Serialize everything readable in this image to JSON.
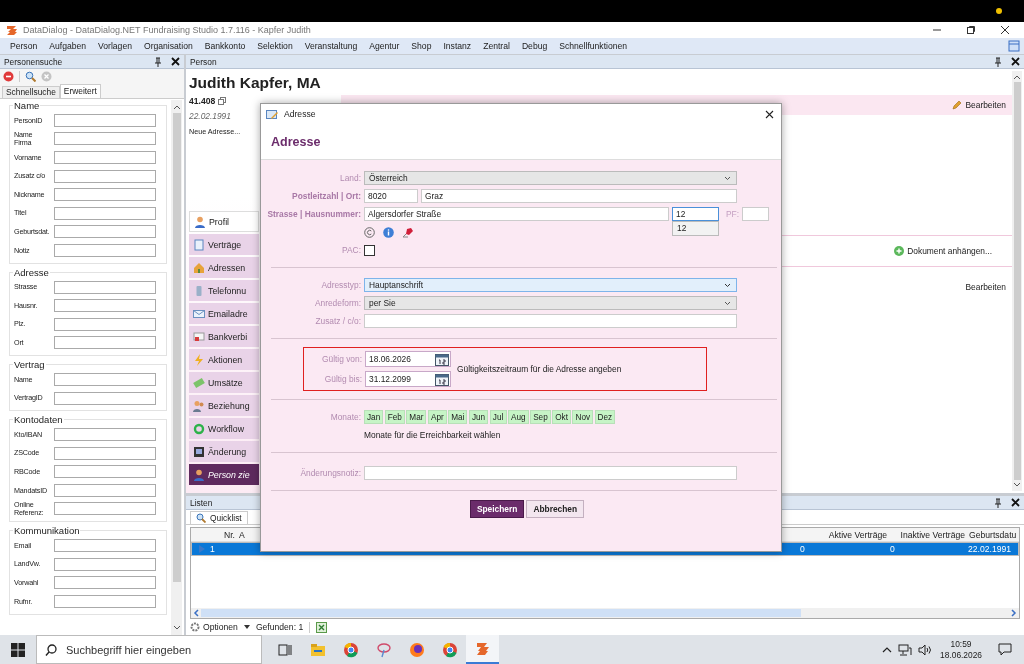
{
  "window": {
    "title": "DataDialog - DataDialog.NET Fundraising Studio 1.7.116 - Kapfer Judith"
  },
  "menu": [
    "Person",
    "Aufgaben",
    "Vorlagen",
    "Organisation",
    "Bankkonto",
    "Selektion",
    "Veranstaltung",
    "Agentur",
    "Shop",
    "Instanz",
    "Zentral",
    "Debug",
    "Schnellfunktionen"
  ],
  "search_panel": {
    "title": "Personensuche",
    "tabs": [
      {
        "label": "Schnellsuche",
        "selected": false
      },
      {
        "label": "Erweitert",
        "selected": true
      }
    ],
    "groups": [
      {
        "title": "Name",
        "fields": [
          "PersonID",
          "Name\nFirma",
          "Vorname",
          "Zusatz c/o",
          "Nickname",
          "Titel",
          "Geburtsdat.",
          "Notiz"
        ]
      },
      {
        "title": "Adresse",
        "fields": [
          "Strasse",
          "Hausnr.",
          "Plz.",
          "Ort"
        ]
      },
      {
        "title": "Vertrag",
        "fields": [
          "Name",
          "VertragID"
        ]
      },
      {
        "title": "Kontodaten",
        "fields": [
          "Kto/IBAN",
          "ZSCode",
          "RBCode",
          "MandatsID",
          "Online\nReferenz:"
        ]
      },
      {
        "title": "Kommunikation",
        "fields": [
          "Email",
          "LandVw.",
          "Vorwahl",
          "Rufnr."
        ]
      }
    ]
  },
  "person_panel": {
    "title": "Person",
    "name": "Judith Kapfer, MA",
    "id": "41.408",
    "birthdate": "22.02.1991",
    "note": "Neue Adresse...",
    "nav": [
      {
        "label": "Profil",
        "selected": true,
        "kind": "page"
      },
      {
        "label": "Verträge",
        "selected": false,
        "kind": "page"
      },
      {
        "label": "Adressen",
        "selected": false,
        "kind": "page"
      },
      {
        "label": "Telefonnu",
        "selected": false,
        "kind": "page"
      },
      {
        "label": "Emailadre",
        "selected": false,
        "kind": "page"
      },
      {
        "label": "Bankverbi",
        "selected": false,
        "kind": "page"
      },
      {
        "label": "Aktionen",
        "selected": false,
        "kind": "page"
      },
      {
        "label": "Umsätze",
        "selected": false,
        "kind": "page"
      },
      {
        "label": "Beziehung",
        "selected": false,
        "kind": "page"
      },
      {
        "label": "Workflow",
        "selected": false,
        "kind": "page"
      },
      {
        "label": "Änderung",
        "selected": false,
        "kind": "page"
      },
      {
        "label": "Person zie",
        "selected": false,
        "kind": "action"
      }
    ],
    "edit_link": "Bearbeiten",
    "attach_link": "Dokument anhängen...",
    "edit_link_2": "Bearbeiten"
  },
  "dialog": {
    "title": "Adresse",
    "heading": "Adresse",
    "country": {
      "label": "Land:",
      "value": "Österreich",
      "required": false
    },
    "postcode": {
      "label": "Postleitzahl | Ort:",
      "postcode": "8020",
      "city": "Graz",
      "required": true
    },
    "street": {
      "label": "Strasse | Hausnummer:",
      "street": "Algersdorfer Straße",
      "number": "12",
      "pf_label": "PF:",
      "suggestions": [
        "12"
      ],
      "required": true
    },
    "pac": {
      "label": "PAC:",
      "checked": false
    },
    "address_type": {
      "label": "Adresstyp:",
      "value": "Hauptanschrift",
      "focused": true
    },
    "salutation": {
      "label": "Anredeform:",
      "value": "per Sie",
      "focused": false
    },
    "extra": {
      "label": "Zusatz / c/o:"
    },
    "valid_from": {
      "label": "Gültig von:",
      "value": "18.06.2026"
    },
    "valid_to": {
      "label": "Gültig bis:",
      "value": "31.12.2099"
    },
    "validity_hint": "Gültigkeitszeitraum für die Adresse angeben",
    "months": {
      "label": "Monate:",
      "hint": "Monate für die Erreichbarkeit wählen",
      "items": [
        {
          "label": "Jan",
          "selected": true
        },
        {
          "label": "Feb",
          "selected": true
        },
        {
          "label": "Mar",
          "selected": true
        },
        {
          "label": "Apr",
          "selected": true
        },
        {
          "label": "Mai",
          "selected": true
        },
        {
          "label": "Jun",
          "selected": true
        },
        {
          "label": "Jul",
          "selected": true
        },
        {
          "label": "Aug",
          "selected": true
        },
        {
          "label": "Sep",
          "selected": true
        },
        {
          "label": "Okt",
          "selected": true
        },
        {
          "label": "Nov",
          "selected": true
        },
        {
          "label": "Dez",
          "selected": true
        }
      ]
    },
    "change_note": {
      "label": "Änderungsnotiz:"
    },
    "buttons": [
      {
        "label": "Speichern",
        "kind": "primary"
      },
      {
        "label": "Abbrechen",
        "kind": "secondary"
      }
    ]
  },
  "lists_panel": {
    "title": "Listen",
    "tab": "Quicklist",
    "columns": [
      "Nr.",
      "A",
      "Aktive Verträge",
      "Inaktive Verträge",
      "Geburtsdatu"
    ],
    "rows": [
      {
        "nr": "1",
        "active": "0",
        "inactive": "0",
        "birthdate": "22.02.1991",
        "selected": true
      }
    ],
    "options": "Optionen",
    "found": "Gefunden: 1"
  },
  "taskbar": {
    "search_placeholder": "Suchbegriff hier eingeben",
    "time": "10:59",
    "date": "18.06.2026",
    "apps": [
      {
        "selected": false
      },
      {
        "selected": false
      },
      {
        "selected": false
      },
      {
        "selected": false
      },
      {
        "selected": false
      },
      {
        "selected": false
      },
      {
        "selected": true
      }
    ]
  }
}
